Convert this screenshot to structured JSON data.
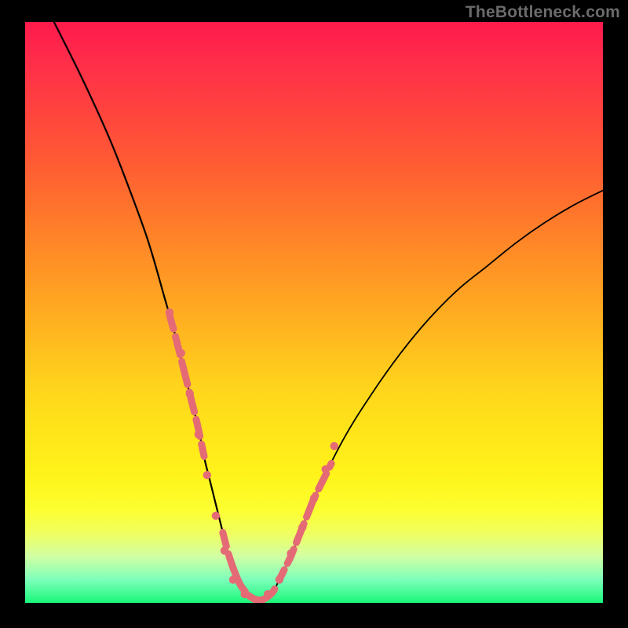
{
  "watermark": "TheBottleneck.com",
  "chart_data": {
    "type": "line",
    "title": "",
    "xlabel": "",
    "ylabel": "",
    "xlim": [
      0,
      100
    ],
    "ylim": [
      0,
      100
    ],
    "background_gradient_top": "#ff1a4d",
    "background_gradient_bottom": "#19f77a",
    "series": [
      {
        "name": "bottleneck-curve",
        "x": [
          5,
          10,
          15,
          20,
          22,
          24,
          26,
          28,
          30,
          31,
          32,
          33,
          34,
          35,
          36,
          37,
          38,
          39,
          40,
          41,
          42,
          43,
          44,
          46,
          48,
          50,
          55,
          60,
          65,
          70,
          75,
          80,
          85,
          90,
          95,
          100
        ],
        "y": [
          100,
          90,
          79,
          66,
          60,
          53,
          46,
          38,
          30,
          25,
          21,
          17,
          13,
          9,
          6,
          3.5,
          2,
          1,
          0.5,
          0.5,
          1,
          2,
          4,
          8,
          13,
          18,
          28,
          36,
          43,
          49,
          54,
          58,
          62,
          65.5,
          68.5,
          71
        ]
      }
    ],
    "highlight_segments": {
      "left_descent": {
        "x_range": [
          25,
          36
        ],
        "color": "#e46b75"
      },
      "valley_bottom": {
        "x_range": [
          36,
          44
        ],
        "color": "#e46b75"
      },
      "right_ascent": {
        "x_range": [
          44,
          53
        ],
        "color": "#e46b75"
      }
    },
    "highlight_points": [
      {
        "x": 25,
        "y": 50
      },
      {
        "x": 27,
        "y": 43
      },
      {
        "x": 28.5,
        "y": 36
      },
      {
        "x": 30,
        "y": 29
      },
      {
        "x": 31.5,
        "y": 22
      },
      {
        "x": 33,
        "y": 15
      },
      {
        "x": 34.5,
        "y": 9
      },
      {
        "x": 36,
        "y": 4
      },
      {
        "x": 38,
        "y": 1.5
      },
      {
        "x": 40,
        "y": 0.5
      },
      {
        "x": 42,
        "y": 1.5
      },
      {
        "x": 44,
        "y": 4
      },
      {
        "x": 46,
        "y": 8.5
      },
      {
        "x": 48,
        "y": 13
      },
      {
        "x": 50,
        "y": 18
      },
      {
        "x": 52,
        "y": 23
      },
      {
        "x": 53.5,
        "y": 27
      }
    ]
  }
}
